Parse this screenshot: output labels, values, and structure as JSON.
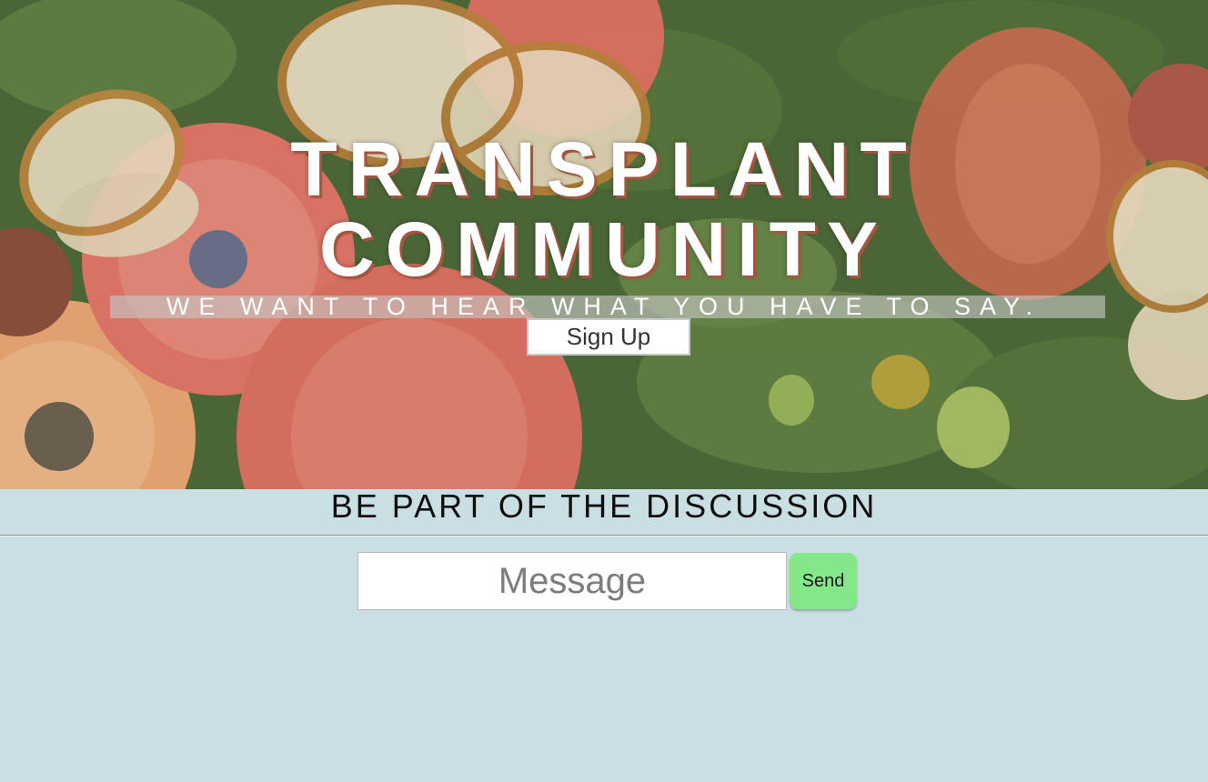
{
  "hero": {
    "title_line1": "TRANSPLANT",
    "title_line2": "COMMUNITY",
    "tagline": "WE WANT TO HEAR WHAT YOU HAVE TO SAY.",
    "signup_label": "Sign Up",
    "background_image": "butterflies-and-daisies-photo"
  },
  "discussion": {
    "heading": "BE PART OF THE DISCUSSION",
    "message_placeholder": "Message",
    "message_value": "",
    "send_label": "Send"
  },
  "colors": {
    "page_background": "#c9dfe4",
    "send_button": "#84e78a",
    "title_text": "#ffffff",
    "title_shadow": "#a4553f"
  }
}
